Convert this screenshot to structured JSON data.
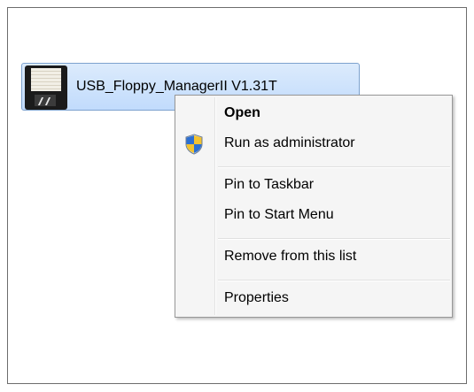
{
  "shortcut": {
    "name": "USB_Floppy_ManagerII V1.31T",
    "icon": "floppy-disk-icon"
  },
  "context_menu": {
    "items": [
      {
        "label": "Open",
        "default": true
      },
      {
        "label": "Run as administrator",
        "icon": "uac-shield-icon"
      },
      {
        "label": "Pin to Taskbar"
      },
      {
        "label": "Pin to Start Menu"
      },
      {
        "label": "Remove from this list"
      },
      {
        "label": "Properties"
      }
    ]
  },
  "colors": {
    "selection_border": "#7da2ce",
    "selection_fill": "#c1dbfc",
    "menu_background": "#f5f5f5"
  }
}
